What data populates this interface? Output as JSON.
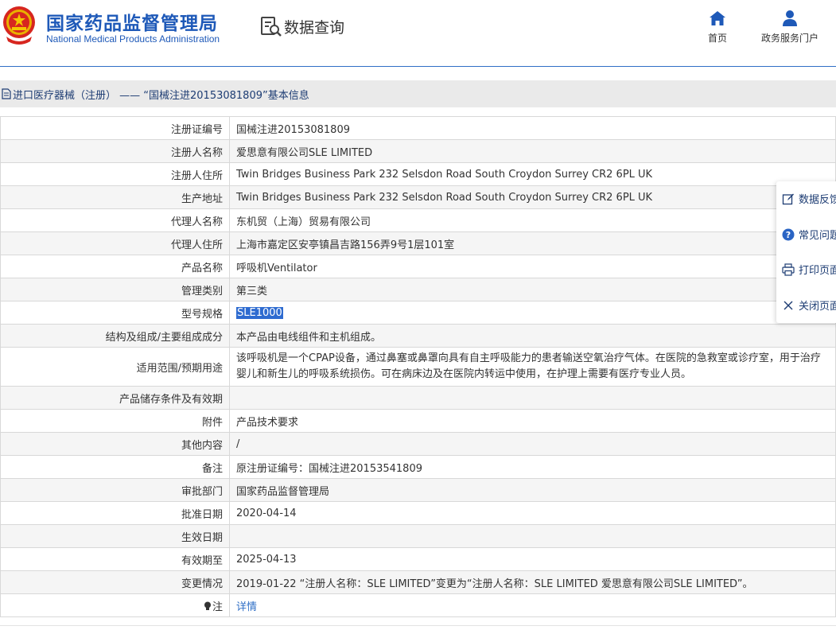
{
  "header": {
    "logo_cn": "国家药品监督管理局",
    "logo_en": "National Medical Products Administration",
    "search_title": "数据查询",
    "nav": [
      {
        "label": "首页",
        "icon": "home-icon"
      },
      {
        "label": "政务服务门户",
        "icon": "user-icon"
      }
    ]
  },
  "breadcrumb": {
    "text": "进口医疗器械（注册） —— “国械注进20153081809”基本信息"
  },
  "rows": [
    {
      "key": "注册证编号",
      "value": "国械注进20153081809"
    },
    {
      "key": "注册人名称",
      "value": "爱思意有限公司SLE LIMITED"
    },
    {
      "key": "注册人住所",
      "value": "Twin Bridges Business Park 232 Selsdon Road South Croydon Surrey CR2 6PL UK"
    },
    {
      "key": "生产地址",
      "value": "Twin Bridges Business Park 232 Selsdon Road South Croydon Surrey CR2 6PL UK"
    },
    {
      "key": "代理人名称",
      "value": "东机贸（上海）贸易有限公司"
    },
    {
      "key": "代理人住所",
      "value": "上海市嘉定区安亭镇昌吉路156弄9号1层101室"
    },
    {
      "key": "产品名称",
      "value": "呼吸机Ventilator"
    },
    {
      "key": "管理类别",
      "value": "第三类"
    },
    {
      "key": "型号规格",
      "value": "SLE1000"
    },
    {
      "key": "结构及组成/主要组成成分",
      "value": "本产品由电线组件和主机组成。"
    },
    {
      "key": "适用范围/预期用途",
      "value": "该呼吸机是一个CPAP设备，通过鼻塞或鼻罩向具有自主呼吸能力的患者输送空氧治疗气体。在医院的急救室或诊疗室，用于治疗婴儿和新生儿的呼吸系统损伤。可在病床边及在医院内转运中使用，在护理上需要有医疗专业人员。"
    },
    {
      "key": "产品储存条件及有效期",
      "value": ""
    },
    {
      "key": "附件",
      "value": "产品技术要求"
    },
    {
      "key": "其他内容",
      "value": "/"
    },
    {
      "key": "备注",
      "value": "原注册证编号：国械注进20153541809"
    },
    {
      "key": "审批部门",
      "value": "国家药品监督管理局"
    },
    {
      "key": "批准日期",
      "value": "2020-04-14"
    },
    {
      "key": "生效日期",
      "value": ""
    },
    {
      "key": "有效期至",
      "value": "2025-04-13"
    },
    {
      "key": "变更情况",
      "value": "2019-01-22 “注册人名称：SLE LIMITED”变更为“注册人名称：SLE LIMITED 爱思意有限公司SLE LIMITED”。"
    },
    {
      "key": "注",
      "value": "详情"
    }
  ],
  "float_panel": [
    {
      "label": "数据反馈",
      "icon": "edit-icon"
    },
    {
      "label": "常见问题",
      "icon": "question-icon"
    },
    {
      "label": "打印页面",
      "icon": "print-icon"
    },
    {
      "label": "关闭页面",
      "icon": "close-icon"
    }
  ],
  "colors": {
    "brand": "#1e59b8",
    "highlight": "#2e6bd0",
    "link": "#2f6fc6"
  }
}
